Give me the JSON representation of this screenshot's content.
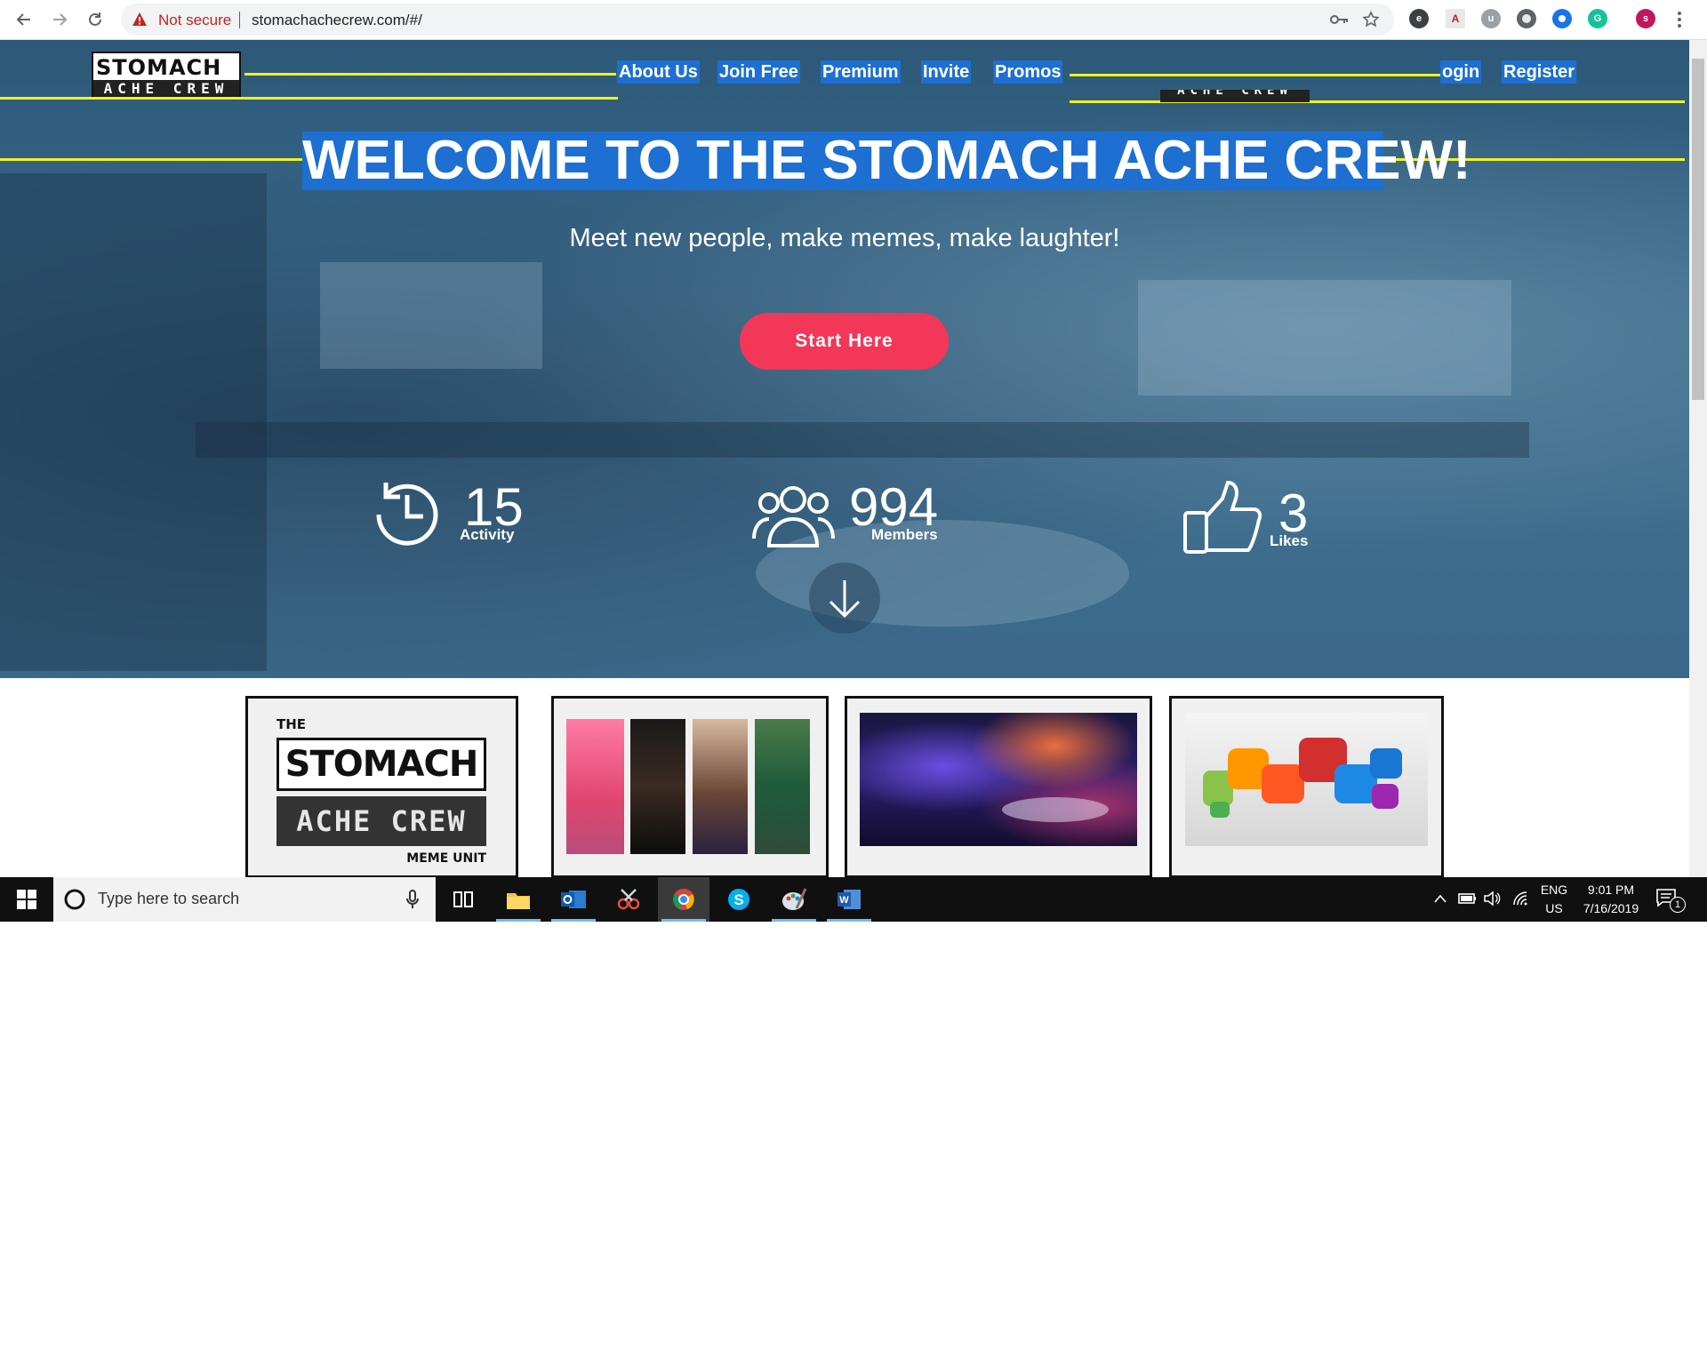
{
  "browser": {
    "security_label": "Not secure",
    "url": "stomachachecrew.com/#/",
    "profile_initial": "s"
  },
  "site": {
    "logo": {
      "top": "STOMACH",
      "bottom": "ACHE CREW"
    },
    "nav": [
      "About Us",
      "Join Free",
      "Premium",
      "Invite",
      "Promos"
    ],
    "auth": {
      "login": "ogin",
      "register": "Register"
    },
    "hero": {
      "title": "WELCOME TO THE STOMACH ACHE CREW!",
      "subtitle": "Meet new people, make memes, make laughter!",
      "cta": "Start Here"
    },
    "stats": [
      {
        "icon": "history-clock-icon",
        "value": "15",
        "label": "Activity"
      },
      {
        "icon": "members-group-icon",
        "value": "994",
        "label": "Members"
      },
      {
        "icon": "thumbs-up-icon",
        "value": "3",
        "label": "Likes"
      }
    ],
    "cards": [
      {
        "icon": "logo-image",
        "text_top": "THE",
        "text_main": "STOMACH",
        "text_sub": "ACHE CREW",
        "text_foot": "MEME UNIT"
      },
      {
        "icon": "people-photos-image"
      },
      {
        "icon": "concert-drummer-image"
      },
      {
        "icon": "social-bubbles-image"
      }
    ]
  },
  "taskbar": {
    "search_placeholder": "Type here to search",
    "lang_top": "ENG",
    "lang_bottom": "US",
    "time": "9:01 PM",
    "date": "7/16/2019",
    "notification_count": "1"
  },
  "colors": {
    "accent_nav": "#1d6fd1",
    "cta": "#f23759",
    "highlight_line": "#f2f21e"
  }
}
